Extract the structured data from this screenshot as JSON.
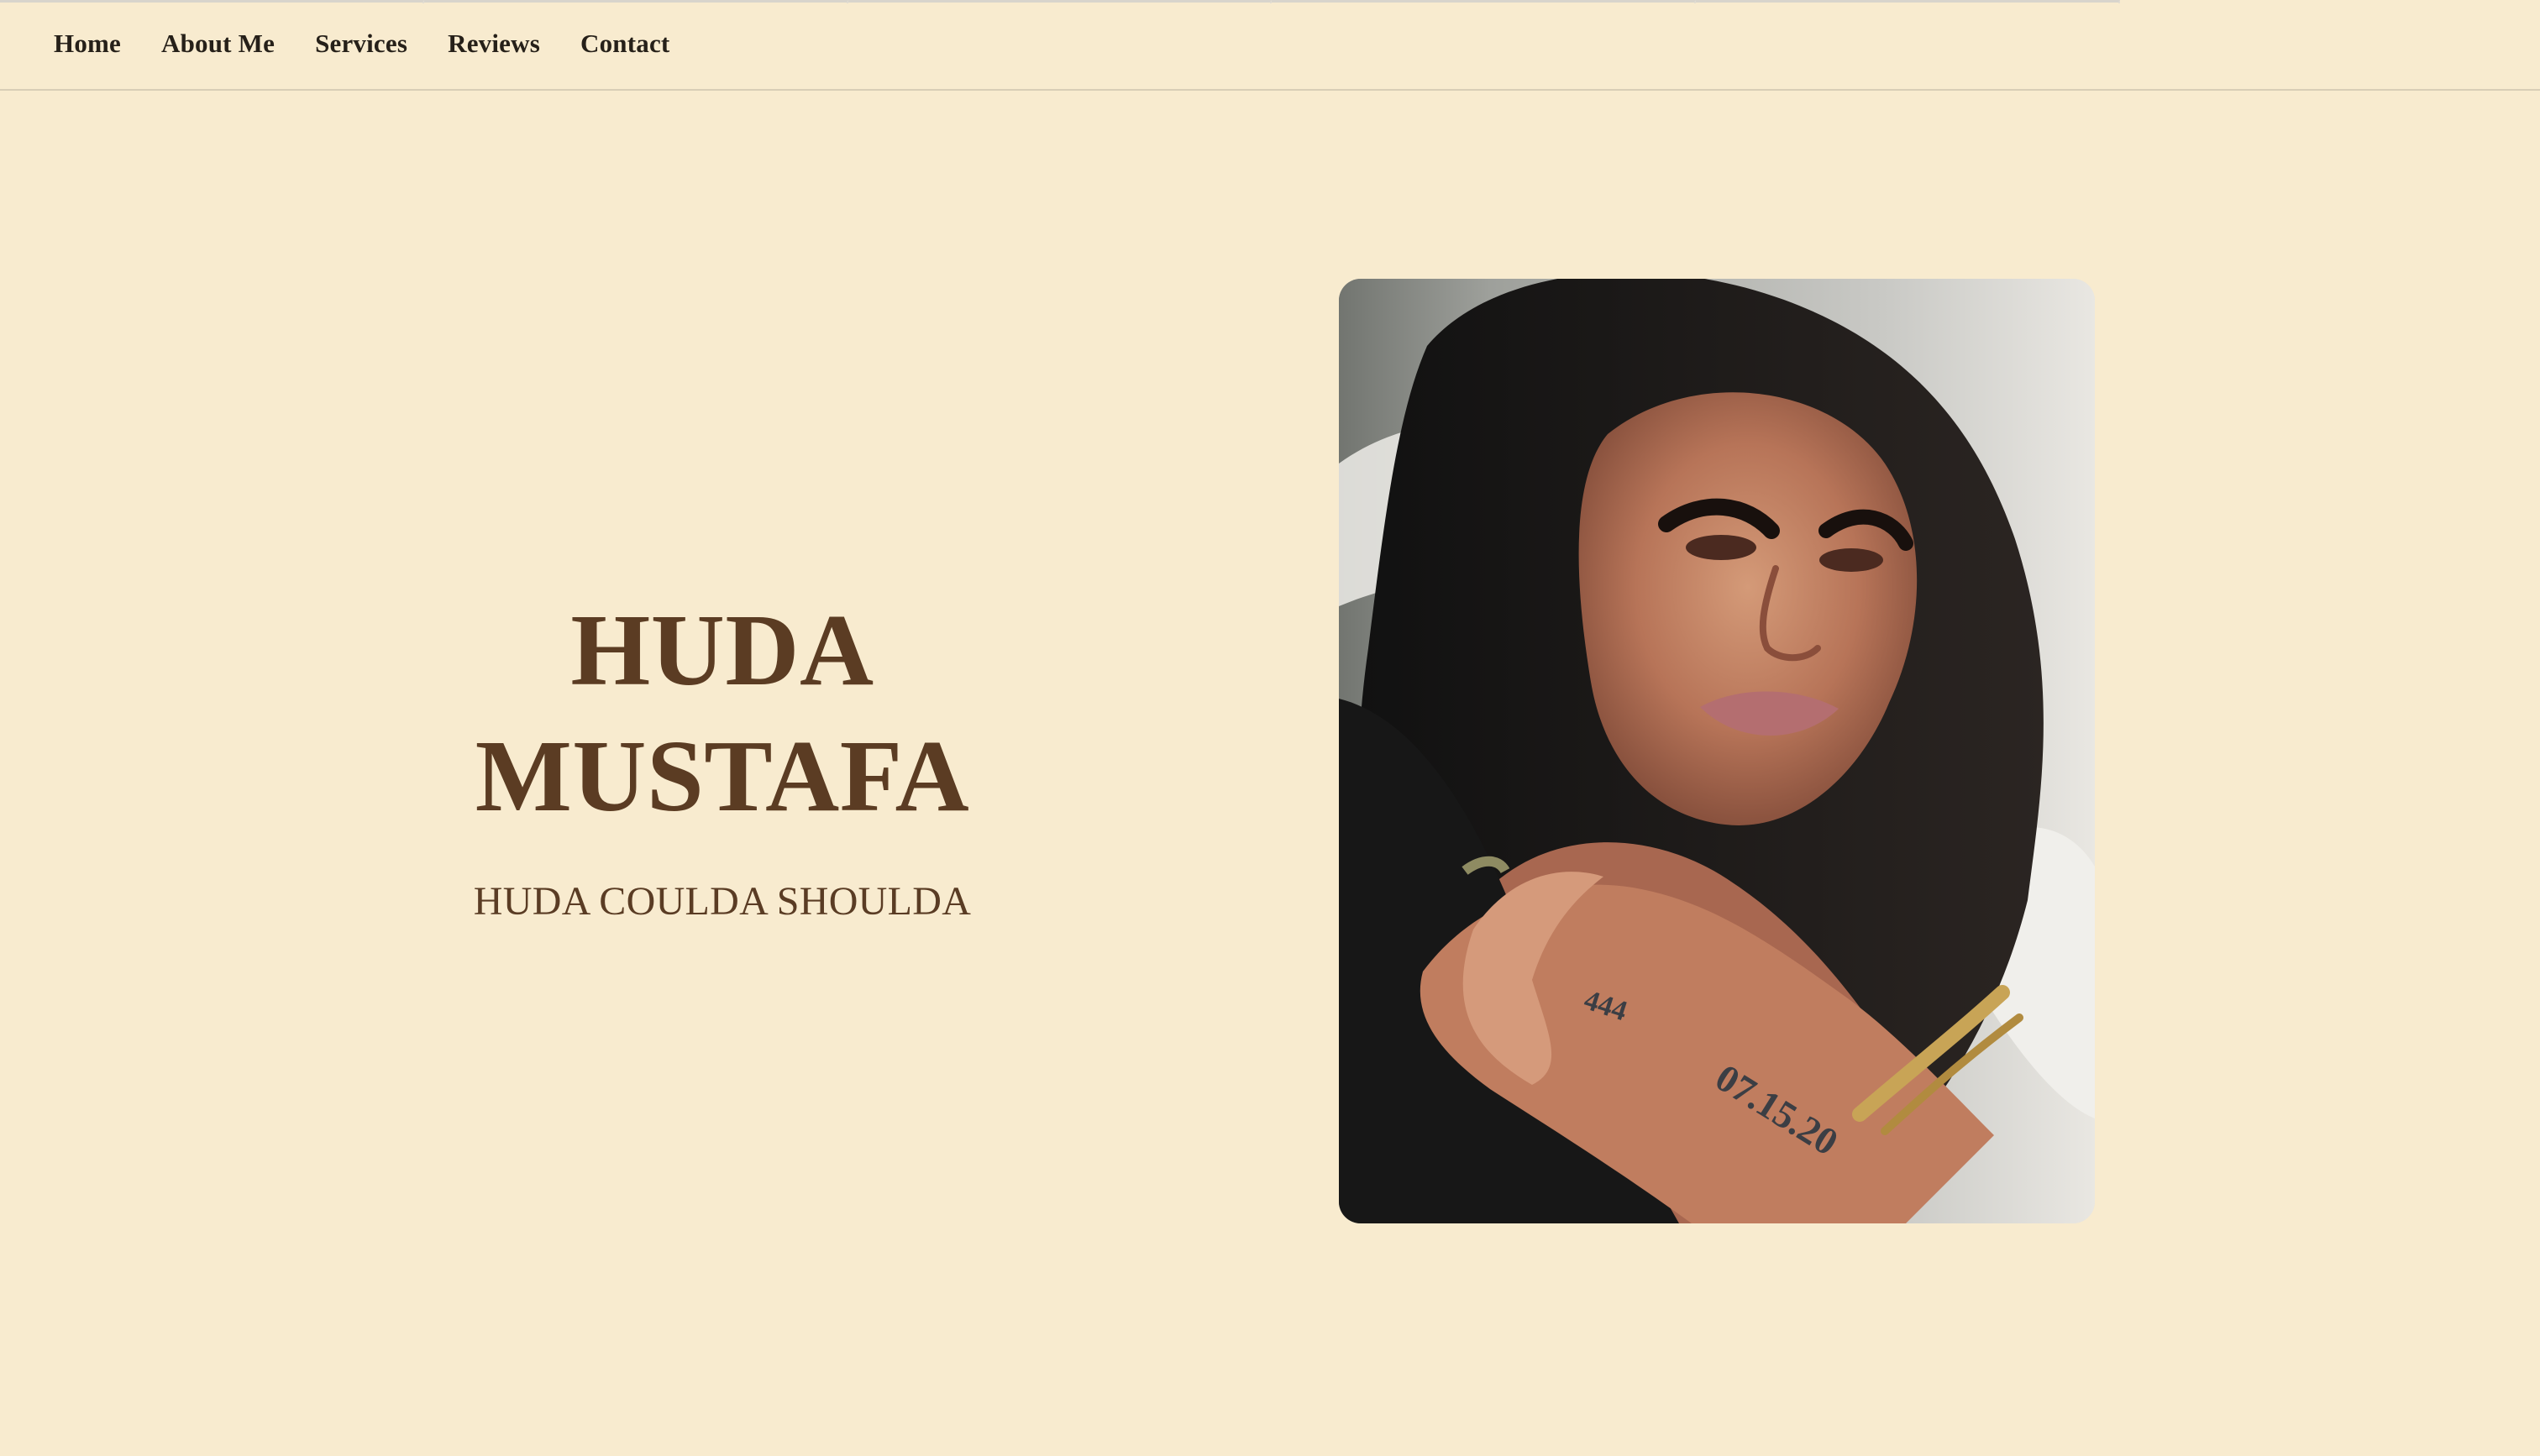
{
  "nav": {
    "items": [
      {
        "label": "Home"
      },
      {
        "label": "About Me"
      },
      {
        "label": "Services"
      },
      {
        "label": "Reviews"
      },
      {
        "label": "Contact"
      }
    ]
  },
  "hero": {
    "name_line1": "HUDA",
    "name_line2": "MUSTAFA",
    "subtitle": "HUDA COULDA SHOULDA",
    "tattoo_text": "07.15.20",
    "tattoo_small": "444"
  },
  "colors": {
    "background": "#f8ebcf",
    "text_dark": "#262019",
    "hero_brown": "#5b3c23"
  }
}
